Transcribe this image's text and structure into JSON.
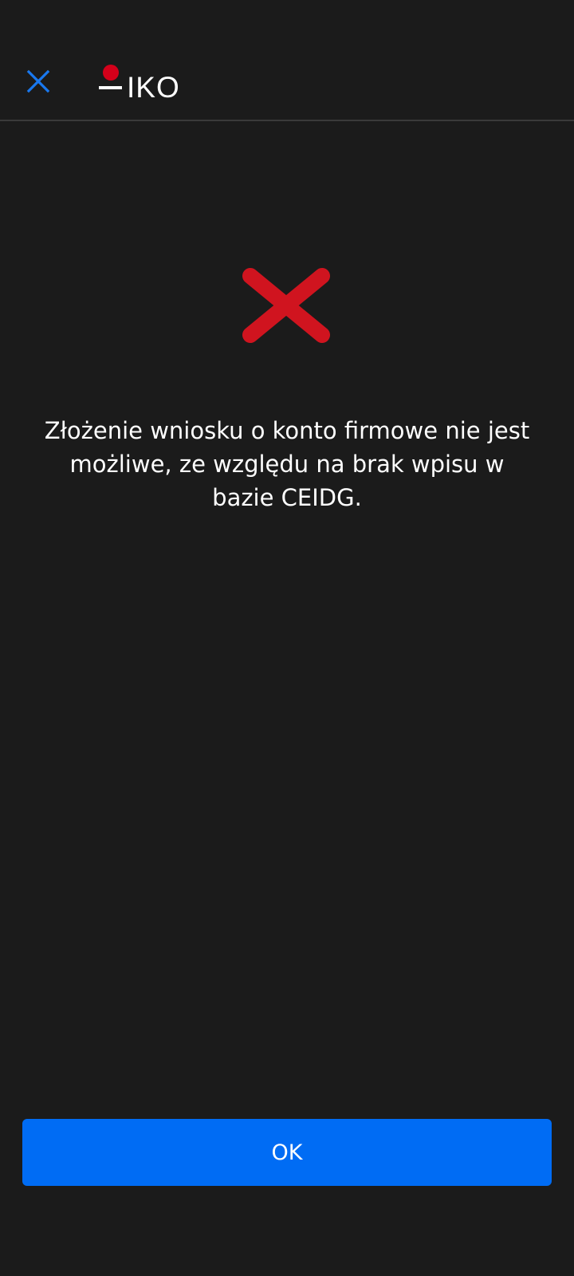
{
  "header": {
    "close_icon": "close-icon",
    "logo_text": "IKO"
  },
  "error": {
    "icon": "error-x-icon",
    "message": "Złożenie wniosku o konto firmowe nie jest możliwe, ze względu na brak wpisu w bazie CEIDG."
  },
  "actions": {
    "ok_label": "OK"
  },
  "colors": {
    "background": "#1b1b1b",
    "accent_blue": "#006cf4",
    "error_red": "#d0141f",
    "logo_red": "#d4001a"
  }
}
